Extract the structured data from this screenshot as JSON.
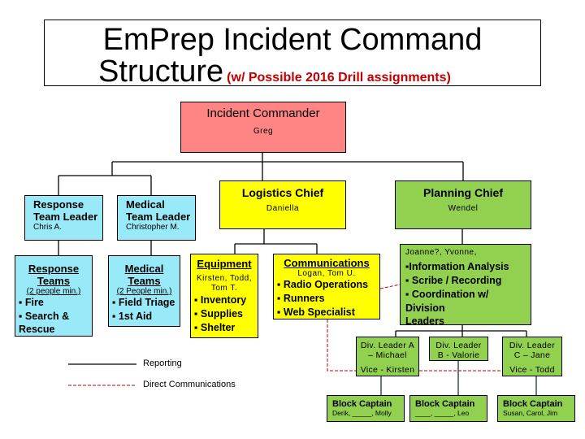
{
  "title": {
    "line1": "EmPrep Incident Command",
    "line2": "Structure",
    "subtitle": "(w/ Possible 2016 Drill assignments)"
  },
  "colors": {
    "commander": "#ff8585",
    "team_leaders": "#99eaf8",
    "logistics": "#ffff00",
    "planning": "#92d050",
    "direct_comm_line": "#c00000"
  },
  "incident_commander": {
    "title": "Incident Commander",
    "name": "Greg"
  },
  "response_team_leader": {
    "title_line1": "Response",
    "title_line2": "Team Leader",
    "name": "Chris A."
  },
  "medical_team_leader": {
    "title_line1": "Medical",
    "title_line2": "Team Leader",
    "name": "Christopher M."
  },
  "logistics_chief": {
    "title": "Logistics Chief",
    "name": "Daniella"
  },
  "planning_chief": {
    "title": "Planning Chief",
    "name": "Wendel"
  },
  "response_teams": {
    "title_line1": "Response",
    "title_line2": "Teams",
    "subtitle": "(2 people min.)",
    "items": [
      "▪ Fire",
      "▪ Search &",
      "Rescue"
    ]
  },
  "medical_teams": {
    "title_line1": "Medical",
    "title_line2": "Teams",
    "subtitle": "(2 People min.)",
    "items": [
      "▪ Field Triage",
      "▪ 1st Aid"
    ]
  },
  "equipment": {
    "title": "Equipment",
    "names_line1": "Kirsten,  Todd,",
    "names_line2": "Tom T.",
    "items": [
      "▪ Inventory",
      "▪ Supplies",
      "▪ Shelter"
    ]
  },
  "communications": {
    "title": "Communications",
    "names": "Logan, Tom U.",
    "items": [
      "▪ Radio Operations",
      "▪ Runners",
      "▪ Web Specialist"
    ]
  },
  "planning_section": {
    "names": "Joanne?, Yvonne,",
    "items": [
      "▪Information Analysis",
      "▪ Scribe / Recording",
      "▪ Coordination w/ Division",
      "Leaders"
    ]
  },
  "division_leaders": [
    {
      "line1": "Div. Leader A",
      "line2": "– Michael",
      "vice": "Vice - Kirsten"
    },
    {
      "line1": "Div. Leader",
      "line2": "B - Valorie",
      "vice": ""
    },
    {
      "line1": "Div. Leader",
      "line2": "C – Jane",
      "vice": "Vice - Todd"
    }
  ],
  "block_captains": [
    {
      "title": "Block Captain",
      "names": "Derik, _____, Molly"
    },
    {
      "title": "Block Captain",
      "names": "____, _____, Leo"
    },
    {
      "title": "Block Captain",
      "names": "Susan, Carol, Jim"
    }
  ],
  "legend": {
    "reporting": "Reporting",
    "direct_communications": "Direct Communications"
  }
}
